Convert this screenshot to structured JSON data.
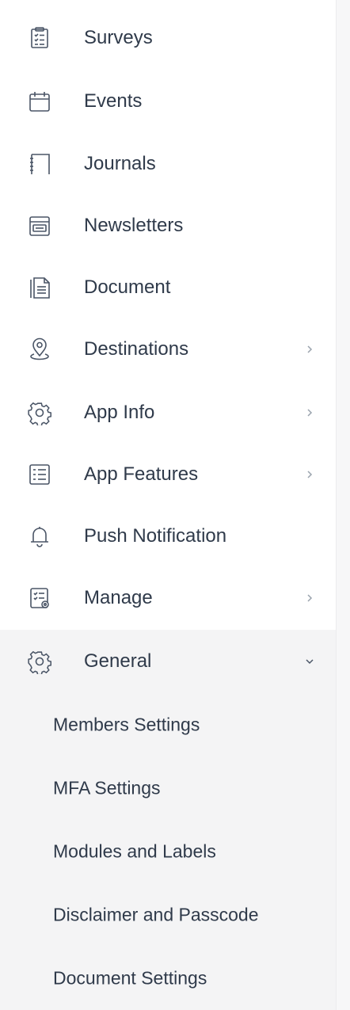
{
  "sidebar": {
    "items": [
      {
        "label": "Surveys",
        "icon": "survey-icon"
      },
      {
        "label": "Events",
        "icon": "calendar-icon"
      },
      {
        "label": "Journals",
        "icon": "journal-icon"
      },
      {
        "label": "Newsletters",
        "icon": "newsletter-icon"
      },
      {
        "label": "Document",
        "icon": "document-icon"
      },
      {
        "label": "Destinations",
        "icon": "location-pin-icon"
      },
      {
        "label": "App Info",
        "icon": "gear-icon"
      },
      {
        "label": "App Features",
        "icon": "list-icon"
      },
      {
        "label": "Push Notification",
        "icon": "bell-icon"
      },
      {
        "label": "Manage",
        "icon": "manage-checklist-icon"
      }
    ],
    "general": {
      "label": "General",
      "icon": "gear-icon",
      "expanded": true,
      "sub_items": [
        {
          "label": "Members Settings"
        },
        {
          "label": "MFA Settings"
        },
        {
          "label": "Modules and Labels"
        },
        {
          "label": "Disclaimer and Passcode"
        },
        {
          "label": "Document Settings"
        }
      ]
    }
  },
  "colors": {
    "text": "#2f3a4a",
    "icon": "#4a5566",
    "chevron": "#9aa3ad",
    "expanded_bg": "#f4f4f5"
  }
}
